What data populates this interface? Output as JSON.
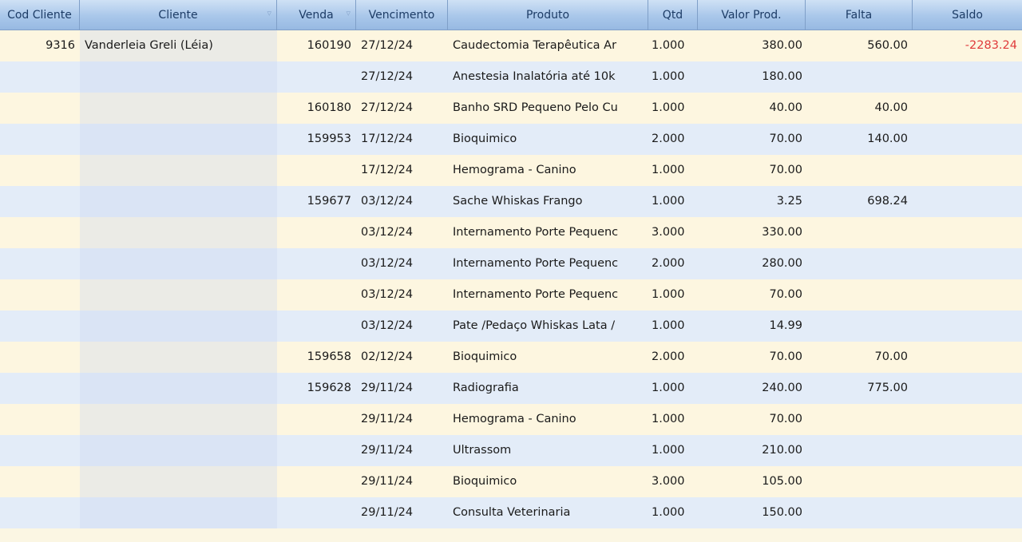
{
  "columns": [
    "Cod Cliente",
    "Cliente",
    "Venda",
    "Vencimento",
    "Produto",
    "Qtd",
    "Valor Prod.",
    "Falta",
    "Saldo"
  ],
  "colors": {
    "header": "#a9c7ea",
    "row_odd": "#fdf6e0",
    "row_even": "#e3ecf8",
    "negative": "#e03b3b"
  },
  "rows": [
    {
      "cod": "9316",
      "cliente": "Vanderleia Greli (Léia)",
      "venda": "160190",
      "venc": "27/12/24",
      "produto": "Caudectomia Terapêutica Ar",
      "qtd": "1.000",
      "valor": "380.00",
      "falta": "560.00",
      "saldo": "-2283.24"
    },
    {
      "cod": "",
      "cliente": "",
      "venda": "",
      "venc": "27/12/24",
      "produto": "Anestesia Inalatória até 10k",
      "qtd": "1.000",
      "valor": "180.00",
      "falta": "",
      "saldo": ""
    },
    {
      "cod": "",
      "cliente": "",
      "venda": "160180",
      "venc": "27/12/24",
      "produto": "Banho SRD Pequeno Pelo Cu",
      "qtd": "1.000",
      "valor": "40.00",
      "falta": "40.00",
      "saldo": ""
    },
    {
      "cod": "",
      "cliente": "",
      "venda": "159953",
      "venc": "17/12/24",
      "produto": "Bioquimico",
      "qtd": "2.000",
      "valor": "70.00",
      "falta": "140.00",
      "saldo": ""
    },
    {
      "cod": "",
      "cliente": "",
      "venda": "",
      "venc": "17/12/24",
      "produto": "Hemograma - Canino",
      "qtd": "1.000",
      "valor": "70.00",
      "falta": "",
      "saldo": ""
    },
    {
      "cod": "",
      "cliente": "",
      "venda": "159677",
      "venc": "03/12/24",
      "produto": "Sache Whiskas Frango",
      "qtd": "1.000",
      "valor": "3.25",
      "falta": "698.24",
      "saldo": ""
    },
    {
      "cod": "",
      "cliente": "",
      "venda": "",
      "venc": "03/12/24",
      "produto": "Internamento Porte Pequenc",
      "qtd": "3.000",
      "valor": "330.00",
      "falta": "",
      "saldo": ""
    },
    {
      "cod": "",
      "cliente": "",
      "venda": "",
      "venc": "03/12/24",
      "produto": "Internamento Porte Pequenc",
      "qtd": "2.000",
      "valor": "280.00",
      "falta": "",
      "saldo": ""
    },
    {
      "cod": "",
      "cliente": "",
      "venda": "",
      "venc": "03/12/24",
      "produto": "Internamento Porte Pequenc",
      "qtd": "1.000",
      "valor": "70.00",
      "falta": "",
      "saldo": ""
    },
    {
      "cod": "",
      "cliente": "",
      "venda": "",
      "venc": "03/12/24",
      "produto": "Pate /Pedaço Whiskas Lata /",
      "qtd": "1.000",
      "valor": "14.99",
      "falta": "",
      "saldo": ""
    },
    {
      "cod": "",
      "cliente": "",
      "venda": "159658",
      "venc": "02/12/24",
      "produto": "Bioquimico",
      "qtd": "2.000",
      "valor": "70.00",
      "falta": "70.00",
      "saldo": ""
    },
    {
      "cod": "",
      "cliente": "",
      "venda": "159628",
      "venc": "29/11/24",
      "produto": "Radiografia",
      "qtd": "1.000",
      "valor": "240.00",
      "falta": "775.00",
      "saldo": ""
    },
    {
      "cod": "",
      "cliente": "",
      "venda": "",
      "venc": "29/11/24",
      "produto": "Hemograma - Canino",
      "qtd": "1.000",
      "valor": "70.00",
      "falta": "",
      "saldo": ""
    },
    {
      "cod": "",
      "cliente": "",
      "venda": "",
      "venc": "29/11/24",
      "produto": "Ultrassom",
      "qtd": "1.000",
      "valor": "210.00",
      "falta": "",
      "saldo": ""
    },
    {
      "cod": "",
      "cliente": "",
      "venda": "",
      "venc": "29/11/24",
      "produto": "Bioquimico",
      "qtd": "3.000",
      "valor": "105.00",
      "falta": "",
      "saldo": ""
    },
    {
      "cod": "",
      "cliente": "",
      "venda": "",
      "venc": "29/11/24",
      "produto": "Consulta Veterinaria",
      "qtd": "1.000",
      "valor": "150.00",
      "falta": "",
      "saldo": ""
    }
  ]
}
